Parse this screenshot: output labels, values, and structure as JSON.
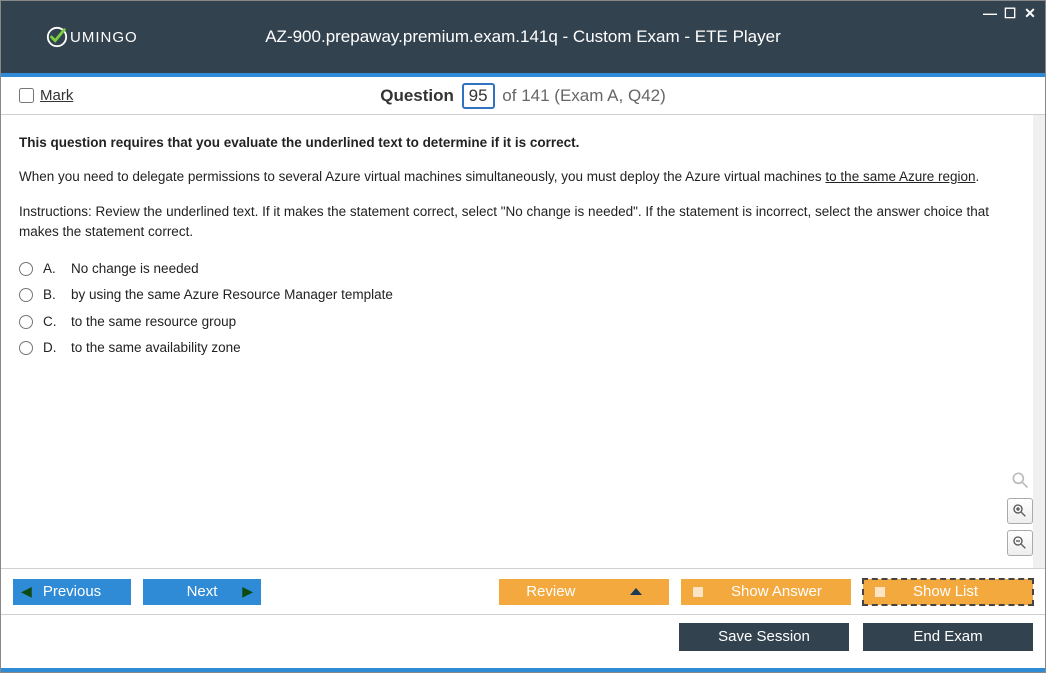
{
  "window": {
    "title": "AZ-900.prepaway.premium.exam.141q - Custom Exam - ETE Player",
    "logo_text": "UMINGO"
  },
  "header": {
    "mark_label": "Mark",
    "question_word": "Question",
    "current_num": "95",
    "of_text": "of 141 (Exam A, Q42)"
  },
  "question": {
    "intro_bold": "This question requires that you evaluate the underlined text to determine if it is correct.",
    "stem_prefix": "When you need to delegate permissions to several Azure virtual machines simultaneously, you must deploy the Azure virtual machines ",
    "stem_underlined": "to the same Azure region",
    "stem_suffix": ".",
    "instructions": "Instructions: Review the underlined text. If it makes the statement correct, select \"No change is needed\". If the statement is incorrect, select the answer choice that makes the statement correct.",
    "options": [
      {
        "letter": "A.",
        "text": "No change is needed"
      },
      {
        "letter": "B.",
        "text": "by using the same Azure Resource Manager template"
      },
      {
        "letter": "C.",
        "text": "to the same resource group"
      },
      {
        "letter": "D.",
        "text": "to the same availability zone"
      }
    ]
  },
  "footer": {
    "previous": "Previous",
    "next": "Next",
    "review": "Review",
    "show_answer": "Show Answer",
    "show_list": "Show List",
    "save_session": "Save Session",
    "end_exam": "End Exam"
  }
}
